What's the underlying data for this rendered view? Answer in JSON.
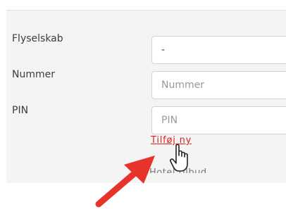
{
  "form": {
    "airline_label": "Flyselskab",
    "airline_value": "-",
    "number_label": "Nummer",
    "number_placeholder": "Nummer",
    "pin_label": "PIN",
    "pin_placeholder": "PIN",
    "add_new_link": "Tilføj ny",
    "next_section_partial": "Hotel tilbud"
  },
  "icons": {
    "cursor": "hand-pointer-icon",
    "arrow": "red-arrow-annotation"
  },
  "colors": {
    "link": "#e0201c",
    "arrow": "#e8332b",
    "panel_bg": "#f4f4f5"
  }
}
